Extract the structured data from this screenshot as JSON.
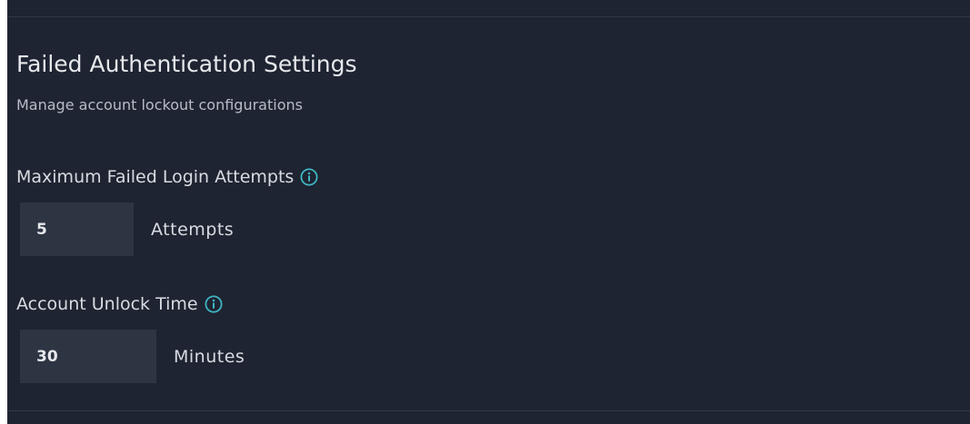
{
  "header": {
    "title": "Failed Authentication Settings",
    "subtitle": "Manage account lockout configurations"
  },
  "fields": {
    "max_attempts": {
      "label": "Maximum Failed Login Attempts",
      "value": "5",
      "unit": "Attempts",
      "icon": "info-icon"
    },
    "unlock_time": {
      "label": "Account Unlock Time",
      "value": "30",
      "unit": "Minutes",
      "icon": "info-icon"
    }
  },
  "colors": {
    "panel_background": "#1e2431",
    "input_background": "#2d3442",
    "accent": "#3fb5c4",
    "text": "#e6e8ec"
  }
}
